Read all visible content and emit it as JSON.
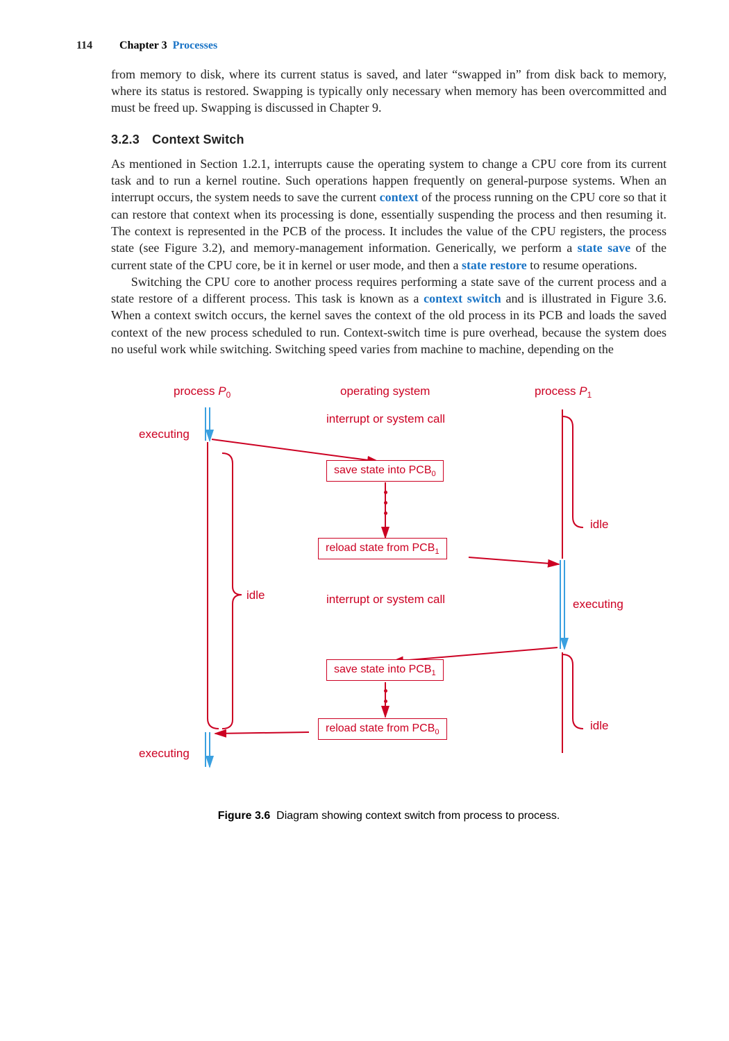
{
  "header": {
    "page_number": "114",
    "chapter": "Chapter 3",
    "chapter_title": "Processes"
  },
  "para1": "from memory to disk, where its current status is saved, and later “swapped in” from disk back to memory, where its status is restored. Swapping is typically only necessary when memory has been overcommitted and must be freed up. Swapping is discussed in Chapter 9.",
  "subhead": "3.2.3 Context Switch",
  "para2a": "As mentioned in Section 1.2.1, interrupts cause the operating system to change a ",
  "para2b": " core from its current task and to run a kernel routine. Such operations happen frequently on general-purpose systems. When an interrupt occurs, the system needs to save the current ",
  "term_context": "context",
  "para2c": " of the process running on the ",
  "para2d": " core so that it can restore that context when its processing is done, essentially suspending the process and then resuming it. The context is represented in the ",
  "para2e": " of the process. It includes the value of the ",
  "para2f": " registers, the process state (see Figure 3.2), and memory-management information. Generically, we perform a ",
  "term_state_save": "state save",
  "para2g": " of the current state of the ",
  "para2h": " core, be it in kernel or user mode, and then a ",
  "term_state_restore": "state restore",
  "para2i": " to resume operations.",
  "para3a": "Switching the ",
  "para3b": " core to another process requires performing a state save of the current process and a state restore of a different process. This task is known as a ",
  "term_context_switch": "context switch",
  "para3c": " and is illustrated in Figure 3.6. When a context switch occurs, the kernel saves the context of the old process in its ",
  "para3d": " and loads the saved context of the new process scheduled to run. Context-switch time is pure overhead, because the system does no useful work while switching. Switching speed varies from machine to machine, depending on the",
  "sc_cpu": "CPU",
  "sc_pcb": "PCB",
  "fig": {
    "col_p0": "process <span class='ital'>P</span><span class='sub'>0</span>",
    "col_os": "operating system",
    "col_p1": "process <span class='ital'>P</span><span class='sub'>1</span>",
    "int_call": "interrupt or system call",
    "save_pcb0": "save state into PCB<span class='sub'>0</span>",
    "reload_pcb1": "reload state from PCB<span class='sub'>1</span>",
    "save_pcb1": "save state into PCB<span class='sub'>1</span>",
    "reload_pcb0": "reload state from PCB<span class='sub'>0</span>",
    "executing": "executing",
    "idle": "idle"
  },
  "caption_bold": "Figure 3.6",
  "caption_rest": "Diagram showing context switch from process to process."
}
